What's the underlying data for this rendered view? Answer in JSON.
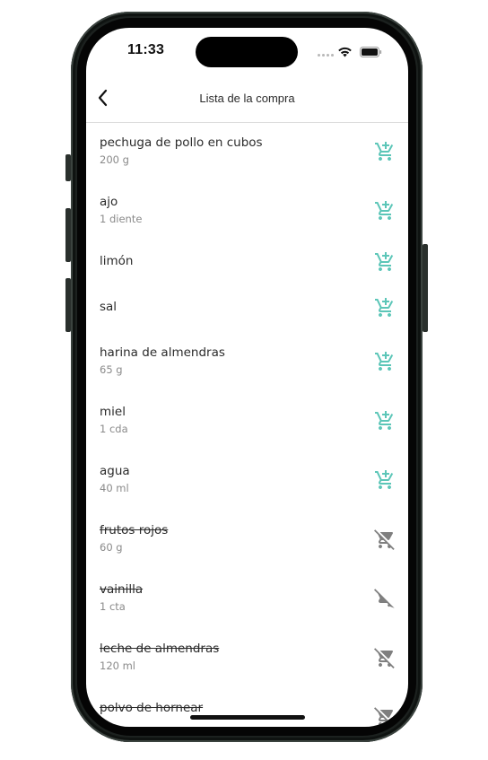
{
  "status_bar": {
    "time": "11:33"
  },
  "header": {
    "title": "Lista de la compra",
    "back_icon": "chevron-left-icon"
  },
  "colors": {
    "accent": "#5cc6b8",
    "inactive_icon": "#7f7f7f",
    "text": "#2b2b2b",
    "subtext": "#8a8a8a"
  },
  "items": [
    {
      "name": "pechuga de pollo en cubos",
      "qty": "200 g",
      "checked": false,
      "icon": "add-to-cart-icon"
    },
    {
      "name": "ajo",
      "qty": "1 diente",
      "checked": false,
      "icon": "add-to-cart-icon"
    },
    {
      "name": "limón",
      "qty": "",
      "checked": false,
      "icon": "add-to-cart-icon"
    },
    {
      "name": "sal",
      "qty": "",
      "checked": false,
      "icon": "add-to-cart-icon"
    },
    {
      "name": "harina de almendras",
      "qty": "65 g",
      "checked": false,
      "icon": "add-to-cart-icon"
    },
    {
      "name": "miel",
      "qty": "1 cda",
      "checked": false,
      "icon": "add-to-cart-icon"
    },
    {
      "name": "agua",
      "qty": "40 ml",
      "checked": false,
      "icon": "add-to-cart-icon"
    },
    {
      "name": "frutos rojos",
      "qty": "60 g",
      "checked": true,
      "icon": "remove-from-cart-icon"
    },
    {
      "name": "vainilla",
      "qty": "1 cta",
      "checked": true,
      "icon": "remove-from-cart-icon"
    },
    {
      "name": "leche de almendras",
      "qty": "120 ml",
      "checked": true,
      "icon": "remove-from-cart-icon"
    },
    {
      "name": "polvo de hornear",
      "qty": "",
      "checked": true,
      "icon": "remove-from-cart-icon"
    }
  ]
}
